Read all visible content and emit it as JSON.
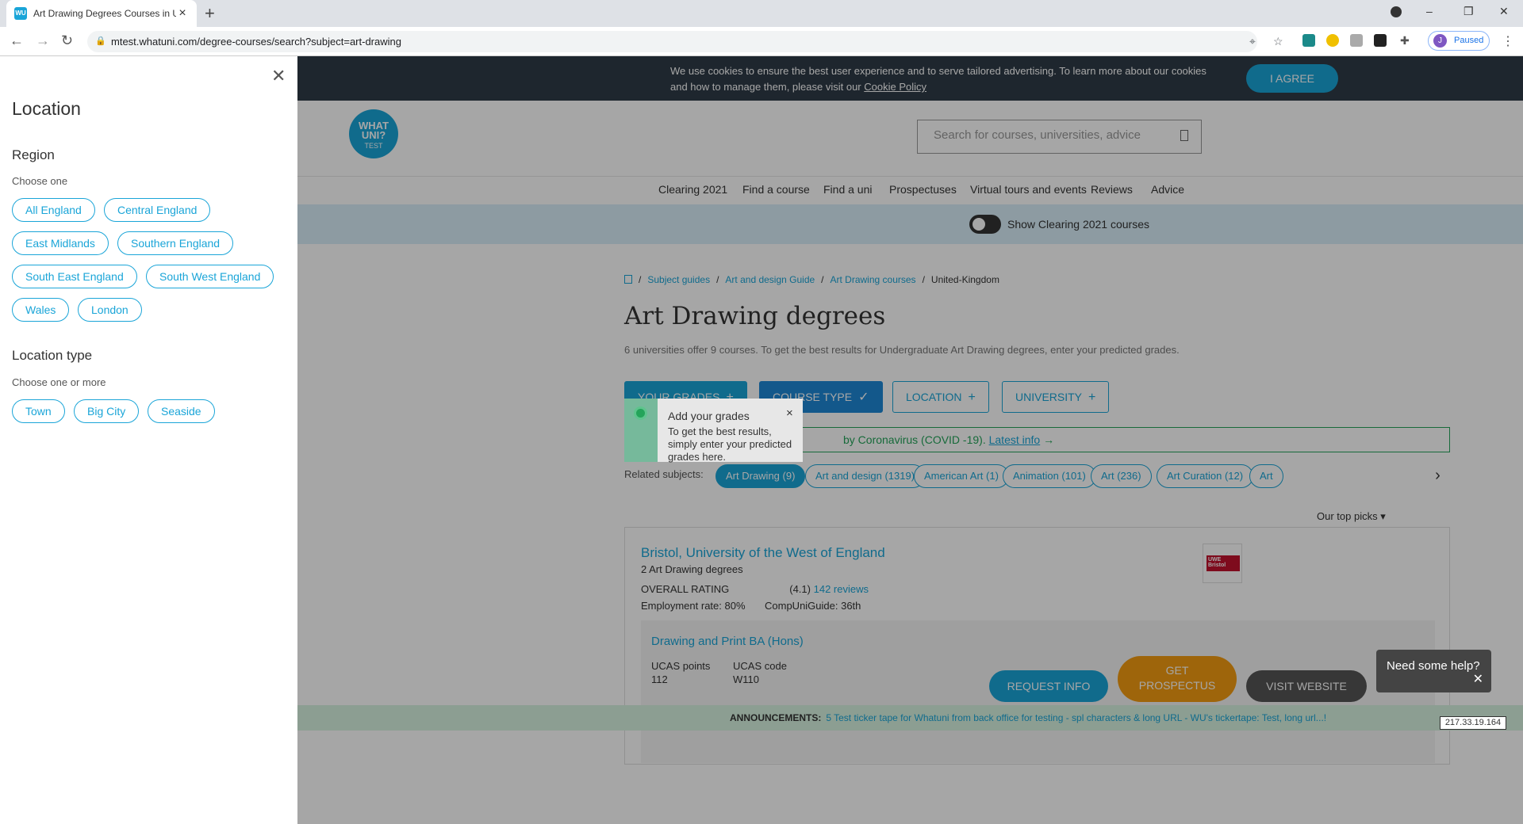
{
  "browser": {
    "tab_title": "Art Drawing Degrees Courses in U",
    "url": "mtest.whatuni.com/degree-courses/search?subject=art-drawing",
    "profile_initial": "J",
    "profile_status": "Paused"
  },
  "cookie": {
    "text": "We use cookies to ensure the best user experience and to serve tailored advertising. To learn more about our cookies and how to manage them, please visit our",
    "link": "Cookie Policy",
    "agree": "I AGREE"
  },
  "header": {
    "logo_line1": "WHAT",
    "logo_line2": "UNI?",
    "logo_line3": "TEST",
    "search_placeholder": "Search for courses, universities, advice"
  },
  "nav": [
    "Clearing 2021",
    "Find a course",
    "Find a uni",
    "Prospectuses",
    "Virtual tours and events",
    "Reviews",
    "Advice"
  ],
  "clearing_toggle": "Show Clearing 2021 courses",
  "breadcrumb": [
    "Subject guides",
    "Art and design Guide",
    "Art Drawing courses",
    "United-Kingdom"
  ],
  "title": "Art Drawing degrees",
  "subtitle": "6 universities offer 9 courses. To get the best results for Undergraduate Art Drawing degrees, enter your predicted grades.",
  "filters": {
    "grades": "YOUR GRADES",
    "course_type": "COURSE TYPE",
    "location": "LOCATION",
    "university": "UNIVERSITY"
  },
  "tooltip": {
    "heading": "Add your grades",
    "body": "To get the best results, simply enter your predicted grades here."
  },
  "covid": {
    "text": "by Coronavirus (COVID -19).",
    "link": "Latest info"
  },
  "related": {
    "label": "Related subjects:",
    "chips": [
      "Art Drawing (9)",
      "Art and design (1319)",
      "American Art (1)",
      "Animation (101)",
      "Art (236)",
      "Art Curation (12)",
      "Art"
    ]
  },
  "top_picks": "Our top picks",
  "result": {
    "uni": "Bristol, University of the West of England",
    "count": "2 Art Drawing degrees",
    "rating_label": "OVERALL RATING",
    "rating_value": "(4.1)",
    "reviews": "142 reviews",
    "employment": "Employment rate: 80%",
    "cug": "CompUniGuide: 36th",
    "logo_text": "UWE Bristol",
    "course_name": "Drawing and Print BA (Hons)",
    "ucas_points_label": "UCAS points",
    "ucas_points": "112",
    "ucas_code_label": "UCAS code",
    "ucas_code": "W110"
  },
  "cta": {
    "request": "REQUEST INFO",
    "prospectus_1": "GET",
    "prospectus_2": "PROSPECTUS",
    "visit": "VISIT WEBSITE"
  },
  "help": "Need some help?",
  "ticker": {
    "label": "ANNOUNCEMENTS:",
    "text": "5 Test ticker tape for Whatuni from back office for testing - spl characters & long URL - WU's tickertape: Test, long url...!"
  },
  "ip": "217.33.19.164",
  "panel": {
    "title": "Location",
    "region_heading": "Region",
    "region_hint": "Choose one",
    "regions": [
      "All England",
      "Central England",
      "East Midlands",
      "Southern England",
      "South East England",
      "South West England",
      "Wales",
      "London"
    ],
    "type_heading": "Location type",
    "type_hint": "Choose one or more",
    "types": [
      "Town",
      "Big City",
      "Seaside"
    ]
  },
  "colors": {
    "accent": "#1aa5d8",
    "cookie_bg": "#2f3b47",
    "prospectus": "#f39c12",
    "green": "#24a45a"
  }
}
